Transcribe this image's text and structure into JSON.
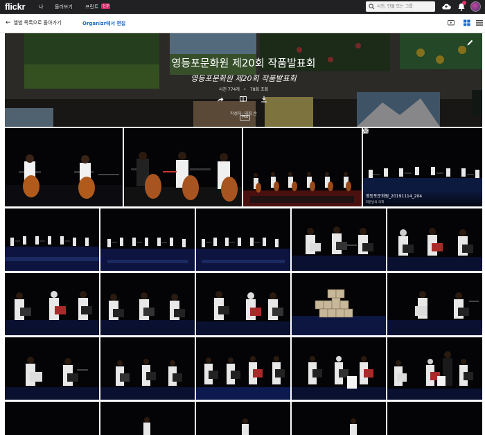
{
  "topnav": {
    "logo": "flickr",
    "items": [
      "나",
      "둘러보기",
      "프린트"
    ],
    "new_badge": "신규",
    "search_placeholder": "사진, 인물 또는 그룹"
  },
  "subnav": {
    "back_label": "앨범 목록으로 돌아가기",
    "organizr_label": "Organizr에서 편집"
  },
  "album": {
    "title": "영등포문화원 제20회 작품발표회",
    "description": "영등포문화원 제20회 작품발표회",
    "photo_count": "사진 774개",
    "separator": "•",
    "views": "78회 조회",
    "author": "작성자: 태희 손",
    "pro_badge": "PRO"
  },
  "hovered_photo": {
    "title": "영등포문화원_20191114_204",
    "author": "회원님의 의해"
  },
  "colors": {
    "nav_bg": "#212124",
    "link_blue": "#1b6ac9",
    "badge_pink": "#d12c6a"
  },
  "icons": [
    "search-icon",
    "upload-icon",
    "bell-icon",
    "share-icon",
    "book-icon",
    "download-icon",
    "pencil-icon",
    "slideshow-icon",
    "grid-view-icon",
    "list-view-icon",
    "star-icon",
    "comment-icon",
    "add-to-album-icon"
  ]
}
